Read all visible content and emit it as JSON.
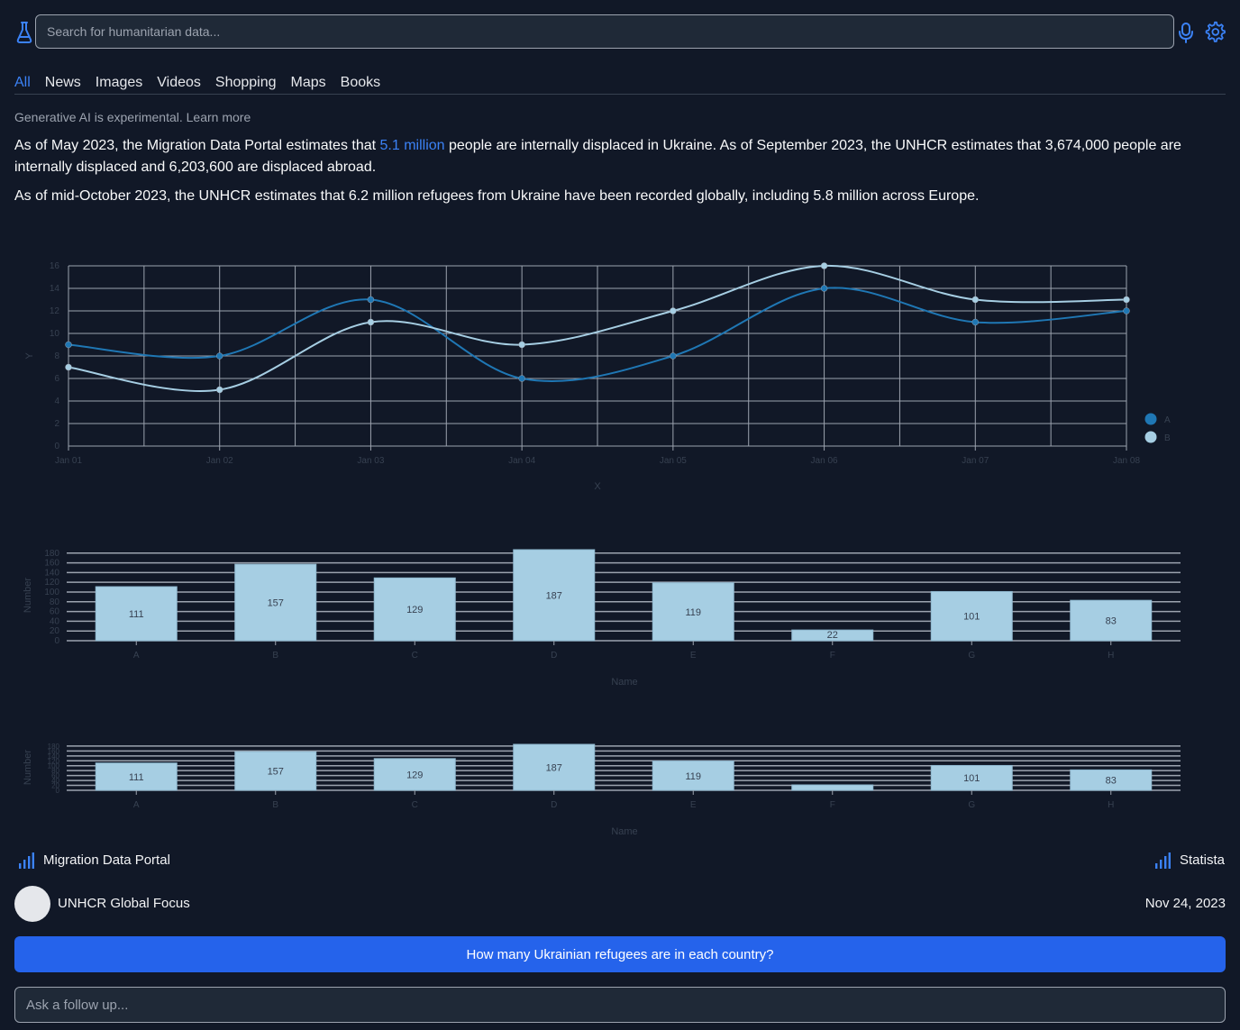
{
  "search": {
    "placeholder": "Search for humanitarian data..."
  },
  "tabs": [
    {
      "label": "All",
      "active": true
    },
    {
      "label": "News",
      "active": false
    },
    {
      "label": "Images",
      "active": false
    },
    {
      "label": "Videos",
      "active": false
    },
    {
      "label": "Shopping",
      "active": false
    },
    {
      "label": "Maps",
      "active": false
    },
    {
      "label": "Books",
      "active": false
    }
  ],
  "answer": {
    "disclaimer": "Generative AI is experimental. Learn more",
    "p1_before": "As of May 2023, the Migration Data Portal estimates that ",
    "p1_link": "5.1 million",
    "p1_after": " people are internally displaced in Ukraine. As of September 2023, the UNHCR estimates that 3,674,000 people are internally displaced and 6,203,600 are displaced abroad.",
    "p2": "As of mid-October 2023, the UNHCR estimates that 6.2 million refugees from Ukraine have been recorded globally, including 5.8 million across Europe."
  },
  "colors": {
    "accent": "#3b82f6",
    "button": "#2563eb",
    "series_a": "#1f77b4",
    "series_b": "#a6cee3",
    "bar": "#a6cee3",
    "background": "#111827"
  },
  "chart_data": [
    {
      "type": "line",
      "x": [
        "Jan 01",
        "Jan 02",
        "Jan 03",
        "Jan 04",
        "Jan 05",
        "Jan 06",
        "Jan 07",
        "Jan 08"
      ],
      "series": [
        {
          "name": "A",
          "values": [
            9,
            8,
            13,
            6,
            8,
            14,
            11,
            12
          ]
        },
        {
          "name": "B",
          "values": [
            7,
            5,
            11,
            9,
            12,
            16,
            13,
            13
          ]
        }
      ],
      "yticks": [
        0,
        2,
        4,
        6,
        8,
        10,
        12,
        14,
        16
      ],
      "xlabel": "X",
      "ylabel": "Y",
      "ylim": [
        0,
        16
      ],
      "grid": true,
      "legend": "right"
    },
    {
      "type": "bar",
      "categories": [
        "A",
        "B",
        "C",
        "D",
        "E",
        "F",
        "G",
        "H"
      ],
      "values": [
        111,
        157,
        129,
        187,
        119,
        22,
        101,
        83
      ],
      "yticks": [
        0,
        20,
        40,
        60,
        80,
        100,
        120,
        140,
        160,
        180
      ],
      "xlabel": "Name",
      "ylabel": "Number",
      "ylim": [
        0,
        187
      ],
      "grid": true
    },
    {
      "type": "bar",
      "categories": [
        "A",
        "B",
        "C",
        "D",
        "E",
        "F",
        "G",
        "H"
      ],
      "values": [
        111,
        157,
        129,
        187,
        119,
        22,
        101,
        83
      ],
      "yticks": [
        0,
        20,
        40,
        60,
        80,
        100,
        120,
        140,
        160,
        180
      ],
      "xlabel": "Name",
      "ylabel": "Number",
      "ylim": [
        0,
        187
      ],
      "grid": true
    }
  ],
  "sources": {
    "left": "Migration Data Portal",
    "right": "Statista",
    "publisher": "UNHCR Global Focus",
    "date": "Nov 24, 2023"
  },
  "actions": {
    "suggested_question": "How many Ukrainian refugees are in each country?",
    "followup_placeholder": "Ask a follow up..."
  },
  "icons": [
    "flask-icon",
    "mic-icon",
    "gear-icon",
    "bar-chart-icon"
  ]
}
